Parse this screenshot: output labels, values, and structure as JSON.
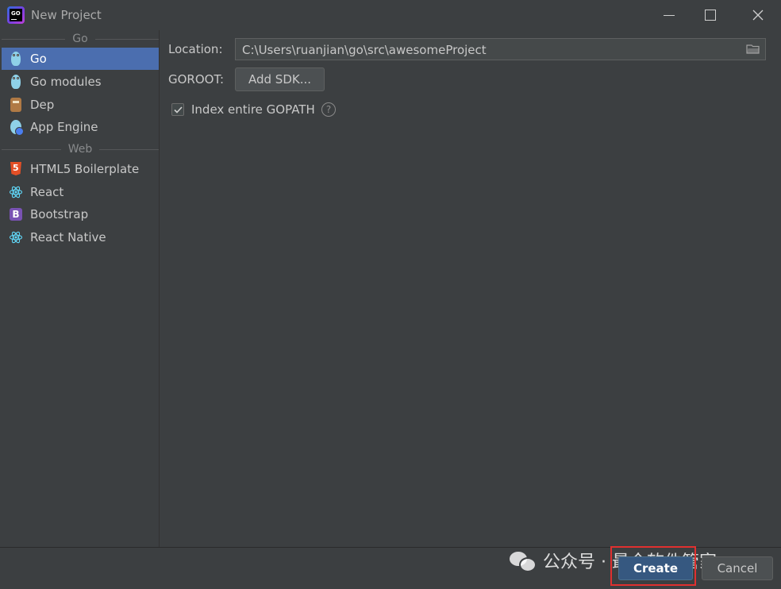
{
  "window": {
    "title": "New Project",
    "app_icon_text": "GO"
  },
  "sidebar": {
    "groups": [
      {
        "header": "Go",
        "items": [
          {
            "label": "Go",
            "icon": "gopher-icon",
            "selected": true
          },
          {
            "label": "Go modules",
            "icon": "gopher-icon"
          },
          {
            "label": "Dep",
            "icon": "dep-icon"
          },
          {
            "label": "App Engine",
            "icon": "app-engine-icon"
          }
        ]
      },
      {
        "header": "Web",
        "items": [
          {
            "label": "HTML5 Boilerplate",
            "icon": "html5-icon"
          },
          {
            "label": "React",
            "icon": "react-icon"
          },
          {
            "label": "Bootstrap",
            "icon": "bootstrap-icon"
          },
          {
            "label": "React Native",
            "icon": "react-icon"
          }
        ]
      }
    ]
  },
  "form": {
    "location_label": "Location:",
    "location_value": "C:\\Users\\ruanjian\\go\\src\\awesomeProject",
    "goroot_label": "GOROOT:",
    "add_sdk_label": "Add SDK...",
    "index_gopath_label": "Index entire GOPATH",
    "index_gopath_checked": true,
    "help_symbol": "?"
  },
  "footer": {
    "create_label": "Create",
    "cancel_label": "Cancel"
  },
  "watermark": {
    "text": "公众号 · 最全软件管家"
  },
  "colors": {
    "background": "#3c3f41",
    "selection": "#4b6eaf",
    "default_button": "#365880",
    "highlight_box": "#e0302f"
  }
}
